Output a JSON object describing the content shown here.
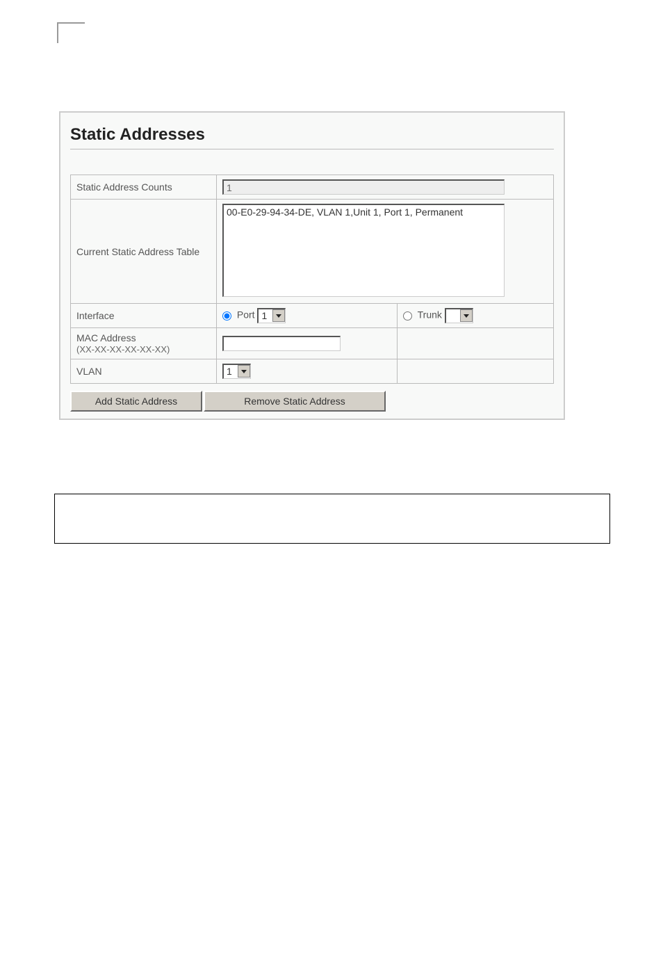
{
  "panel": {
    "title": "Static Addresses"
  },
  "rows": {
    "count_label": "Static Address Counts",
    "count_value": "1",
    "table_label": "Current Static Address Table",
    "table_entries": [
      "00-E0-29-94-34-DE, VLAN 1,Unit 1, Port 1, Permanent"
    ],
    "interface_label": "Interface",
    "port_label": "Port",
    "port_value": "1",
    "trunk_label": "Trunk",
    "trunk_value": "",
    "mac_label_line1": "MAC Address",
    "mac_label_line2": "(XX-XX-XX-XX-XX-XX)",
    "mac_value": "",
    "vlan_label": "VLAN",
    "vlan_value": "1"
  },
  "buttons": {
    "add": "Add Static Address",
    "remove": "Remove Static Address"
  }
}
